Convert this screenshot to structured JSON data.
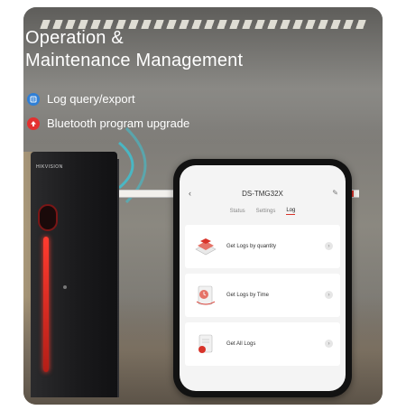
{
  "title_line1": "Operation &",
  "title_line2": "Maintenance Management",
  "features": [
    {
      "label": "Log query/export",
      "icon": "log-icon",
      "color": "#2f7fd6"
    },
    {
      "label": "Bluetooth program upgrade",
      "icon": "upgrade-arrow-icon",
      "color": "#e3302f"
    }
  ],
  "cabinet_brand": "HIKVISION",
  "app": {
    "device_name": "DS-TMG32X",
    "tabs": [
      "Status",
      "Settings",
      "Log"
    ],
    "active_tab": "Log",
    "items": [
      {
        "label": "Get Logs by quantity",
        "icon": "stack-icon"
      },
      {
        "label": "Get Logs by Time",
        "icon": "clock-doc-icon"
      },
      {
        "label": "Get All Logs",
        "icon": "document-icon"
      }
    ]
  },
  "colors": {
    "accent_red": "#d8342a",
    "feature_blue": "#2f7fd6",
    "feature_red": "#e3302f"
  }
}
